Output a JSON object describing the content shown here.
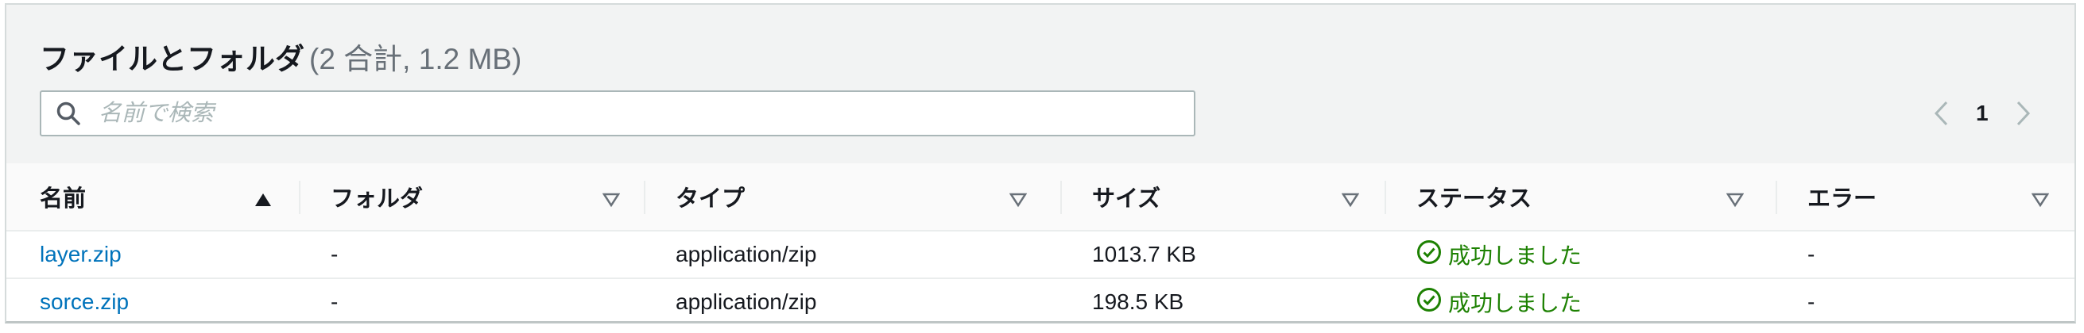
{
  "header": {
    "title": "ファイルとフォルダ",
    "count": "(2 合計, 1.2 MB)"
  },
  "search": {
    "placeholder": "名前で検索",
    "icon": "search-icon"
  },
  "pagination": {
    "current_page": "1",
    "prev_icon": "chevron-left-icon",
    "next_icon": "chevron-right-icon"
  },
  "table": {
    "columns": [
      {
        "label": "名前",
        "sort": "ascending"
      },
      {
        "label": "フォルダ",
        "sort": "none"
      },
      {
        "label": "タイプ",
        "sort": "none"
      },
      {
        "label": "サイズ",
        "sort": "none"
      },
      {
        "label": "ステータス",
        "sort": "none"
      },
      {
        "label": "エラー",
        "sort": "none"
      }
    ],
    "rows": [
      {
        "name": "layer.zip",
        "folder": "-",
        "type": "application/zip",
        "size": "1013.7 KB",
        "status": "成功しました",
        "error": "-"
      },
      {
        "name": "sorce.zip",
        "folder": "-",
        "type": "application/zip",
        "size": "198.5 KB",
        "status": "成功しました",
        "error": "-"
      }
    ]
  },
  "colors": {
    "link": "#0073bb",
    "success": "#1d8102",
    "header_bg": "#f2f3f3"
  }
}
